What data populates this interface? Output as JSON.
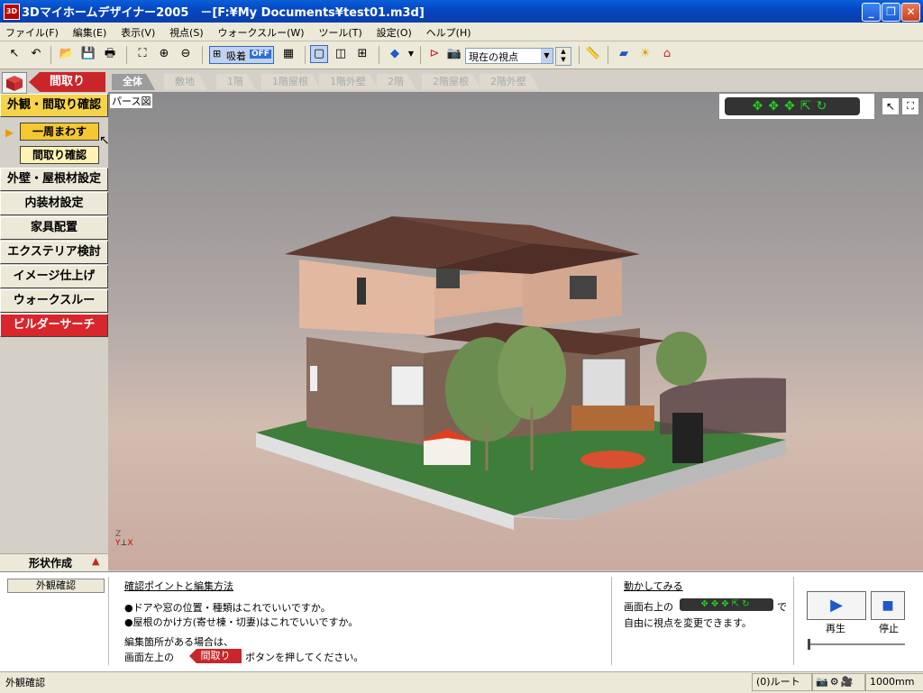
{
  "window": {
    "title": "3Dマイホームデザイナー2005　－[F:¥My Documents¥test01.m3d]",
    "icon": "3D"
  },
  "menu": [
    "ファイル(F)",
    "編集(E)",
    "表示(V)",
    "視点(S)",
    "ウォークスルー(W)",
    "ツール(T)",
    "設定(O)",
    "ヘルプ(H)"
  ],
  "toolbar": {
    "snap_label": "吸着",
    "snap_state": "OFF",
    "viewpoint": "現在の視点"
  },
  "left": {
    "madori_label": "間取り",
    "confirm_label": "外観・間取り確認",
    "rotate_label": "一周まわす",
    "floorplan_check_label": "間取り確認",
    "wall_roof_label": "外壁・屋根材設定",
    "interior_label": "内装材設定",
    "furniture_label": "家具配置",
    "exterior_label": "エクステリア検討",
    "image_label": "イメージ仕上げ",
    "walkthrough_label": "ウォークスルー",
    "builder_label": "ビルダーサーチ",
    "shape_label": "形状作成"
  },
  "tabs": [
    "全体",
    "敷地",
    "1階",
    "1階屋根",
    "1階外壁",
    "2階",
    "2階屋根",
    "2階外壁"
  ],
  "viewport": {
    "title": "パース図",
    "axis": "Z\nY⊥X"
  },
  "info": {
    "mode": "外観確認",
    "check_title": "確認ポイントと編集方法",
    "check_line1": "●ドアや窓の位置・種類はこれでいいですか。",
    "check_line2": "●屋根のかけ方(寄せ棟・切妻)はこれでいいですか。",
    "edit_line1": "編集箇所がある場合は、",
    "edit_line2a": "画面左上の",
    "edit_btn": "間取り",
    "edit_line2b": "ボタンを押してください。",
    "try_title": "動かしてみる",
    "try_line1a": "画面右上の",
    "try_line1b": "で",
    "try_line2": "自由に視点を変更できます。",
    "play": "再生",
    "stop": "停止"
  },
  "status": {
    "text": "外観確認",
    "route": "(0)ルート",
    "scale": "1000mm"
  },
  "colors": {
    "accent": "#c8262a",
    "active": "#f5d34a",
    "nav": "#22d422"
  }
}
